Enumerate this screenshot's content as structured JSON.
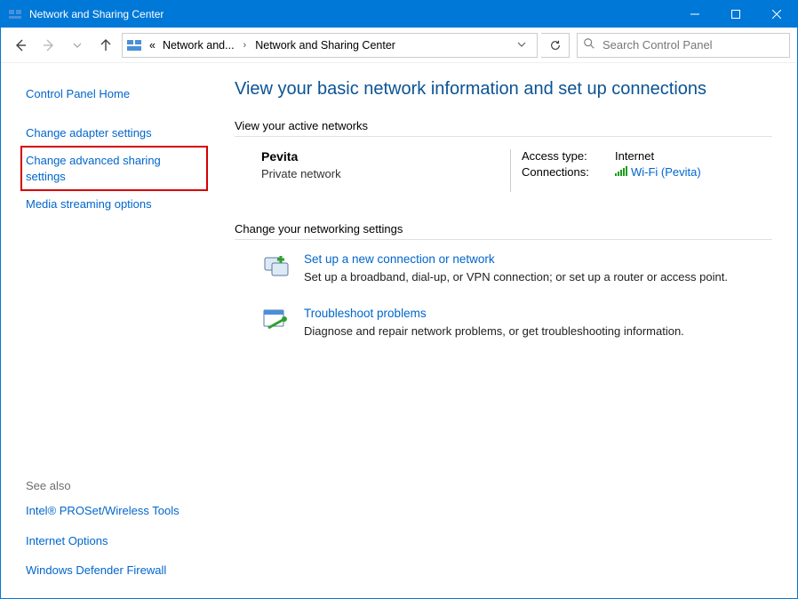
{
  "window": {
    "title": "Network and Sharing Center"
  },
  "nav": {
    "breadcrumb_truncated": "Network and...",
    "breadcrumb_current": "Network and Sharing Center",
    "breadcrumb_prefix": "«",
    "search_placeholder": "Search Control Panel"
  },
  "sidebar": {
    "home": "Control Panel Home",
    "adapter": "Change adapter settings",
    "advanced": "Change advanced sharing settings",
    "media": "Media streaming options",
    "see_also_heading": "See also",
    "see_also": {
      "proset": "Intel® PROSet/Wireless Tools",
      "inetopt": "Internet Options",
      "firewall": "Windows Defender Firewall"
    }
  },
  "main": {
    "page_title": "View your basic network information and set up connections",
    "active_heading": "View your active networks",
    "network": {
      "name": "Pevita",
      "type": "Private network",
      "access_label": "Access type:",
      "access_value": "Internet",
      "conn_label": "Connections:",
      "conn_value": "Wi-Fi (Pevita)"
    },
    "change_heading": "Change your networking settings",
    "setup": {
      "title": "Set up a new connection or network",
      "desc": "Set up a broadband, dial-up, or VPN connection; or set up a router or access point."
    },
    "troubleshoot": {
      "title": "Troubleshoot problems",
      "desc": "Diagnose and repair network problems, or get troubleshooting information."
    }
  }
}
